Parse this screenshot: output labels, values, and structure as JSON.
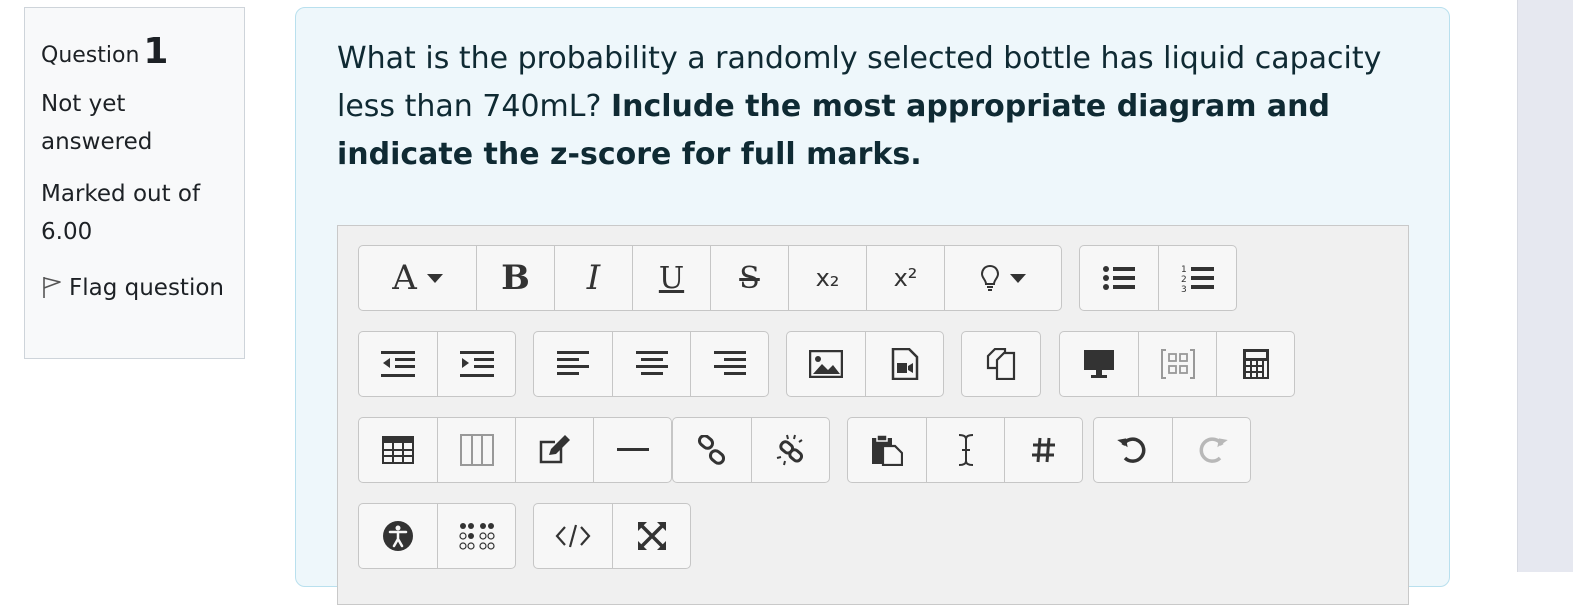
{
  "sidebar": {
    "question_label": "Question",
    "question_number": "1",
    "status": "Not yet answered",
    "marks": "Marked out of 6.00",
    "flag_label": "Flag question"
  },
  "question": {
    "text_plain": "What is the probability a randomly selected bottle has liquid capacity less than 740mL?",
    "text_bold": "Include the most appropriate diagram and indicate the z-score for full marks."
  },
  "toolbar": {
    "font_button_glyph": "A",
    "bold_glyph": "B",
    "italic_glyph": "I",
    "underline_glyph": "U",
    "strike_glyph": "S",
    "subscript_glyph": "x₂",
    "superscript_glyph": "x²",
    "colors": {
      "icon": "#333333",
      "disabled": "#b8b8b8",
      "accent_border": "#b9e0ee",
      "panel_bg": "#eef7fb"
    }
  }
}
